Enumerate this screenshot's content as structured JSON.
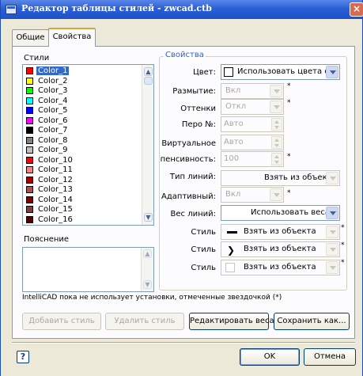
{
  "window": {
    "title": "Редактор таблицы стилей - zwcad.ctb",
    "close_symbol": "×"
  },
  "tabs": [
    {
      "label": "Общие",
      "active": false
    },
    {
      "label": "Свойства",
      "active": true
    }
  ],
  "styles": {
    "label": "Стили",
    "items": [
      {
        "name": "Color_1",
        "color": "#ff0000",
        "selected": true
      },
      {
        "name": "Color_2",
        "color": "#ffff00"
      },
      {
        "name": "Color_3",
        "color": "#00ff00"
      },
      {
        "name": "Color_4",
        "color": "#00ffff"
      },
      {
        "name": "Color_5",
        "color": "#0000ff"
      },
      {
        "name": "Color_6",
        "color": "#ff00ff"
      },
      {
        "name": "Color_7",
        "color": "#000000"
      },
      {
        "name": "Color_8",
        "color": "#808080"
      },
      {
        "name": "Color_9",
        "color": "#c0c0c0"
      },
      {
        "name": "Color_10",
        "color": "#ff0000"
      },
      {
        "name": "Color_11",
        "color": "#ff7f7f"
      },
      {
        "name": "Color_12",
        "color": "#a50000"
      },
      {
        "name": "Color_13",
        "color": "#a55252"
      },
      {
        "name": "Color_14",
        "color": "#7f0000"
      },
      {
        "name": "Color_15",
        "color": "#7f3f3f"
      },
      {
        "name": "Color_16",
        "color": "#4c0000"
      }
    ]
  },
  "note": {
    "label": "Пояснение",
    "value": ""
  },
  "properties": {
    "group_label": "Свойства",
    "color": {
      "label": "Цвет:",
      "value": "Использовать цвета об"
    },
    "dithering": {
      "label": "Размытие:",
      "value": "Вкл"
    },
    "grayscale": {
      "label": "Оттенки",
      "value": "Откл"
    },
    "pen": {
      "label": "Перо №:",
      "value": "Авто"
    },
    "virtual_pen": {
      "label": "Виртуальное",
      "value": "Авто"
    },
    "intensity": {
      "label": "пенсивность:",
      "value": "100"
    },
    "linetype": {
      "label": "Тип линий:",
      "value": "Взять из объекта"
    },
    "adaptive": {
      "label": "Адаптивный:",
      "value": "Вкл"
    },
    "lineweight": {
      "label": "Вес линий:",
      "value": "Использовать веса"
    },
    "end_style": {
      "label": "Стиль",
      "value": "Взять из объекта"
    },
    "join_style": {
      "label": "Стиль",
      "value": "Взять из объекта"
    },
    "fill_style": {
      "label": "Стиль",
      "value": "Взять из объекта"
    },
    "asterisk": "*"
  },
  "footnote": "IntelliCAD пока не использует установки, отмеченные звездочкой (*)",
  "buttons": {
    "add_style": "Добавить стиль",
    "delete_style": "Удалить стиль",
    "edit_weights": "Редактировать веса...",
    "save_as": "Сохранить как...",
    "ok": "OK",
    "cancel": "Отмена",
    "help": "?"
  }
}
